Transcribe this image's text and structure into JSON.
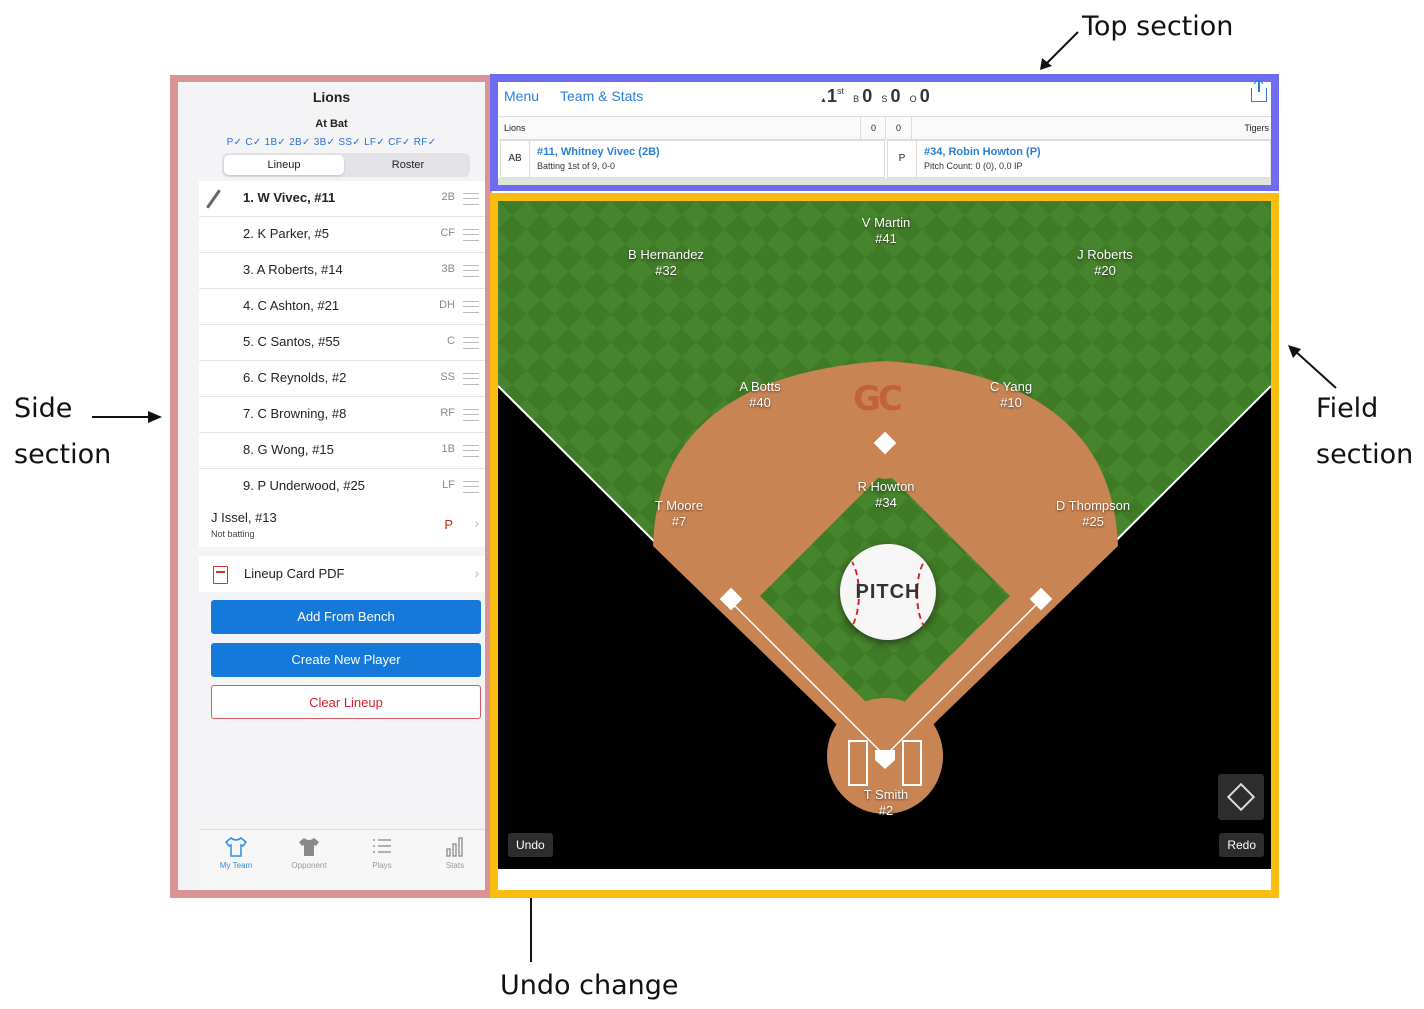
{
  "annotations": {
    "top_section": "Top section",
    "side_section_line1": "Side",
    "side_section_line2": "section",
    "field_section_line1": "Field",
    "field_section_line2": "section",
    "undo_change": "Undo change"
  },
  "colors": {
    "side_frame": "#d99595",
    "top_frame": "#6f6cf2",
    "field_frame": "#fbbd12",
    "primary_blue": "#1479d8",
    "clear_red": "#d01f2e",
    "grass": "#3e7a26",
    "infield_dirt": "#c98453"
  },
  "side": {
    "team_name": "Lions",
    "at_bat_label": "At Bat",
    "position_checks": "P✓ C✓ 1B✓ 2B✓ 3B✓ SS✓ LF✓ CF✓ RF✓",
    "tabs": {
      "lineup": "Lineup",
      "roster": "Roster",
      "selected": "Lineup"
    },
    "lineup": [
      {
        "name": "1. W Vivec, #11",
        "pos": "2B",
        "at_bat": true
      },
      {
        "name": "2. K Parker, #5",
        "pos": "CF"
      },
      {
        "name": "3. A Roberts, #14",
        "pos": "3B"
      },
      {
        "name": "4. C Ashton, #21",
        "pos": "DH"
      },
      {
        "name": "5. C Santos, #55",
        "pos": "C"
      },
      {
        "name": "6. C Reynolds, #2",
        "pos": "SS"
      },
      {
        "name": "7. C Browning, #8",
        "pos": "RF"
      },
      {
        "name": "8. G Wong, #15",
        "pos": "1B"
      },
      {
        "name": "9. P Underwood, #25",
        "pos": "LF"
      }
    ],
    "bench_player": {
      "name": "J Issel, #13",
      "status": "Not batting",
      "pos": "P"
    },
    "lineup_card": "Lineup Card PDF",
    "buttons": {
      "add_from_bench": "Add From Bench",
      "create_new_player": "Create New Player",
      "clear_lineup": "Clear Lineup"
    },
    "tabbar": [
      {
        "label": "My Team",
        "icon": "jersey-outline-icon",
        "active": true
      },
      {
        "label": "Opponent",
        "icon": "jersey-filled-icon",
        "active": false
      },
      {
        "label": "Plays",
        "icon": "list-icon",
        "active": false
      },
      {
        "label": "Stats",
        "icon": "bar-chart-icon",
        "active": false
      }
    ]
  },
  "top": {
    "menu": "Menu",
    "team_stats": "Team & Stats",
    "inning_arrow": "▲",
    "inning": "1",
    "inning_suffix": "st",
    "balls_label": "B",
    "balls": "0",
    "strikes_label": "S",
    "strikes": "0",
    "outs_label": "O",
    "outs": "0",
    "home_team": "Lions",
    "away_team": "Tigers",
    "score_1": "0",
    "score_2": "0",
    "batter_tag": "AB",
    "batter_name": "#11, Whitney Vivec (2B)",
    "batter_info": "Batting 1st of 9, 0-0",
    "pitcher_tag": "P",
    "pitcher_name": "#34, Robin Howton (P)",
    "pitcher_info": "Pitch Count: 0 (0), 0.0 IP"
  },
  "field": {
    "logo": "GC",
    "pitch_label": "PITCH",
    "undo": "Undo",
    "redo": "Redo",
    "players": [
      {
        "id": "cf",
        "name": "V Martin",
        "num": "#41"
      },
      {
        "id": "lf",
        "name": "B Hernandez",
        "num": "#32"
      },
      {
        "id": "rf",
        "name": "J Roberts",
        "num": "#20"
      },
      {
        "id": "ss",
        "name": "A Botts",
        "num": "#40"
      },
      {
        "id": "2b",
        "name": "C Yang",
        "num": "#10"
      },
      {
        "id": "p",
        "name": "R Howton",
        "num": "#34"
      },
      {
        "id": "3b",
        "name": "T Moore",
        "num": "#7"
      },
      {
        "id": "1b",
        "name": "D Thompson",
        "num": "#25"
      },
      {
        "id": "c",
        "name": "T Smith",
        "num": "#2"
      }
    ]
  }
}
